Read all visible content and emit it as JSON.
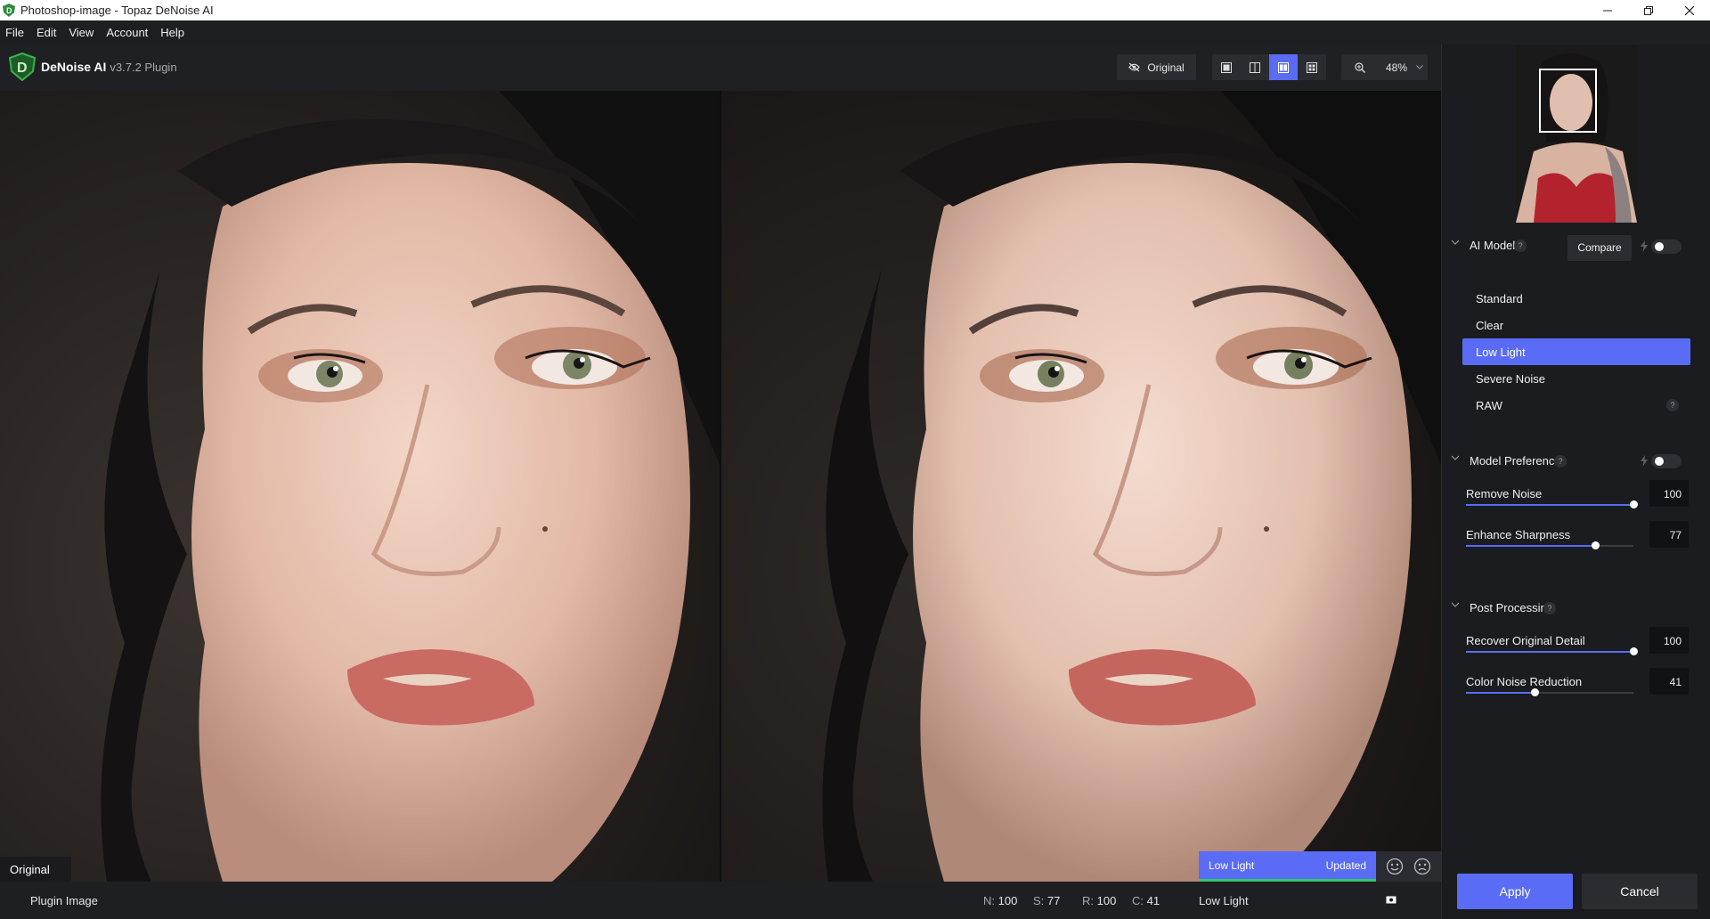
{
  "window": {
    "title": "Photoshop-image - Topaz DeNoise AI"
  },
  "menu": [
    {
      "label": "File"
    },
    {
      "label": "Edit"
    },
    {
      "label": "View"
    },
    {
      "label": "Account"
    },
    {
      "label": "Help"
    }
  ],
  "toolbar": {
    "app_name": "DeNoise AI",
    "version": "v3.7.2 Plugin",
    "original_button": "Original",
    "view_modes": [
      "single-view-icon",
      "split-view-icon",
      "side-by-side-view-icon",
      "quad-view-icon"
    ],
    "active_view_index": 2,
    "zoom_value": "48%"
  },
  "viewer": {
    "original_label": "Original",
    "processed_model": "Low Light",
    "processed_status": "Updated"
  },
  "status_bar": {
    "source": "Plugin Image",
    "n_key": "N:",
    "n_val": "100",
    "s_key": "S:",
    "s_val": "77",
    "r_key": "R:",
    "r_val": "100",
    "c_key": "C:",
    "c_val": "41",
    "model": "Low Light"
  },
  "sidebar": {
    "ai_model": {
      "title": "AI Model",
      "help": "?",
      "compare_label": "Compare",
      "auto_enabled": false,
      "items": [
        {
          "label": "Standard"
        },
        {
          "label": "Clear"
        },
        {
          "label": "Low Light"
        },
        {
          "label": "Severe Noise"
        },
        {
          "label": "RAW"
        }
      ],
      "selected_index": 2,
      "raw_help": "?"
    },
    "model_preferences": {
      "title": "Model Preferences",
      "help": "?",
      "auto_enabled": false,
      "sliders": [
        {
          "label": "Remove Noise",
          "value": "100",
          "fraction": 1.0
        },
        {
          "label": "Enhance Sharpness",
          "value": "77",
          "fraction": 0.77
        }
      ]
    },
    "post_processing": {
      "title": "Post Processing",
      "help": "?",
      "sliders": [
        {
          "label": "Recover Original Detail",
          "value": "100",
          "fraction": 1.0
        },
        {
          "label": "Color Noise Reduction",
          "value": "41",
          "fraction": 0.41
        }
      ]
    },
    "apply_label": "Apply",
    "cancel_label": "Cancel"
  },
  "colors": {
    "accent": "#5a6cf5",
    "progress": "#35c46a",
    "panel": "#1b1c20",
    "background": "#0e0e10"
  }
}
